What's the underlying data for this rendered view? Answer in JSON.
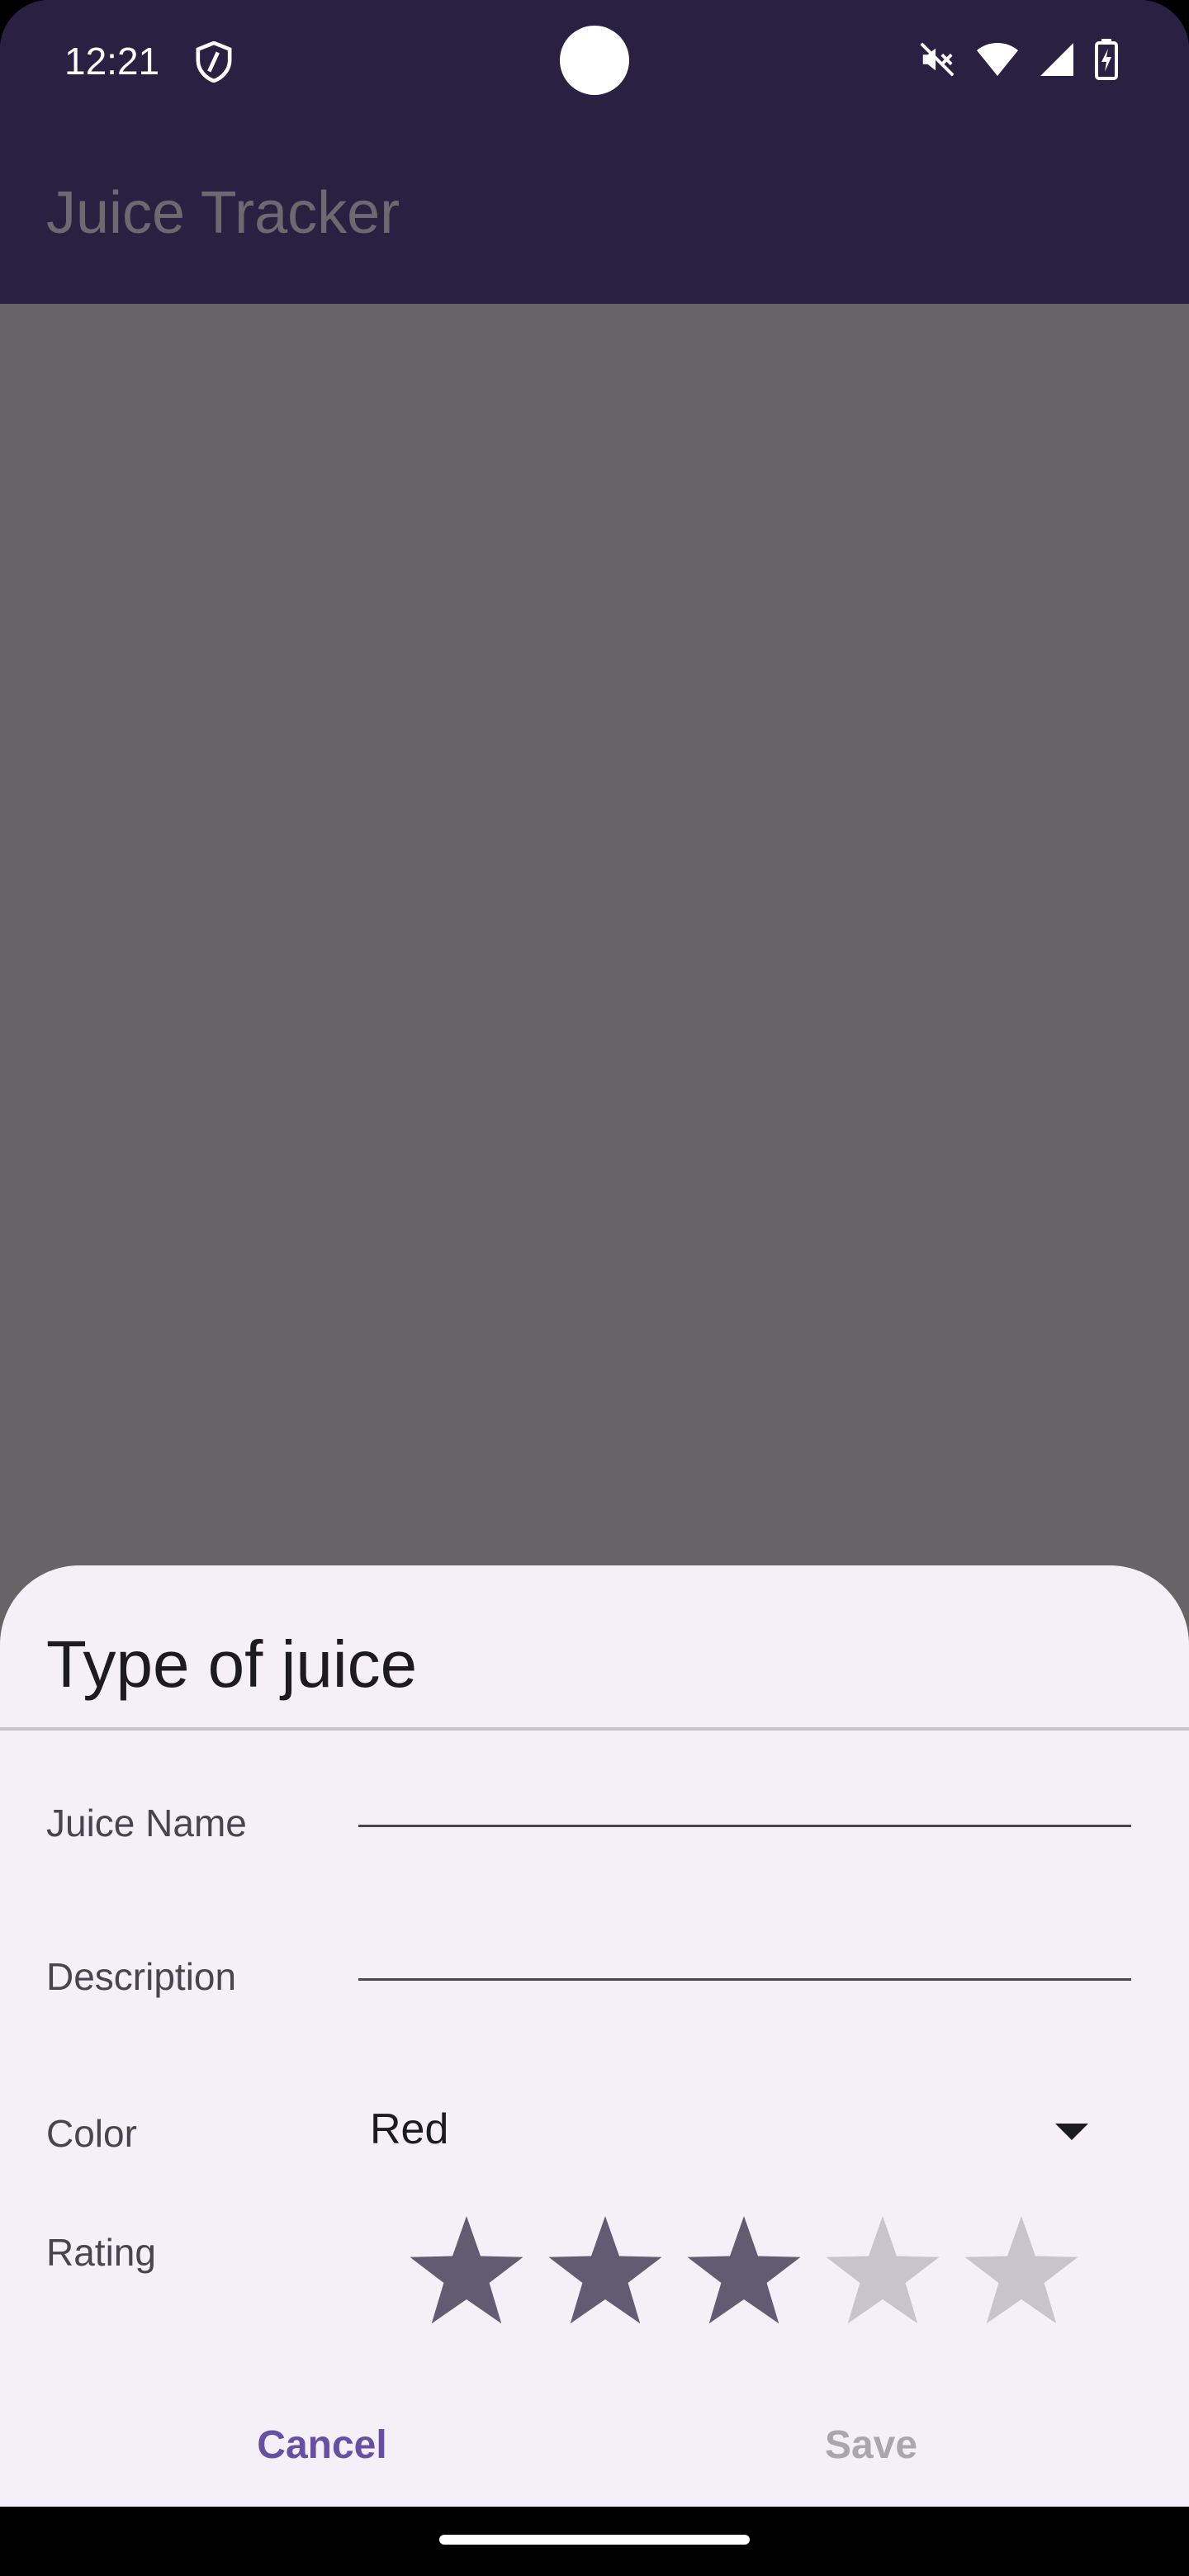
{
  "status_bar": {
    "time": "12:21",
    "icons": [
      "shield-icon",
      "vibrate-off-icon",
      "wifi-icon",
      "signal-icon",
      "battery-charging-icon"
    ]
  },
  "app_bar": {
    "title": "Juice Tracker"
  },
  "sheet": {
    "title": "Type of juice",
    "fields": {
      "name": {
        "label": "Juice Name",
        "value": "",
        "placeholder": ""
      },
      "description": {
        "label": "Description",
        "value": "",
        "placeholder": ""
      },
      "color": {
        "label": "Color",
        "selected": "Red"
      },
      "rating": {
        "label": "Rating",
        "value": 3,
        "max": 5
      }
    },
    "buttons": {
      "cancel": "Cancel",
      "save": "Save"
    }
  },
  "colors": {
    "app_bar": "#2a2042",
    "scrim": "#666467",
    "sheet_bg": "#f5f0f8",
    "accent": "#6750a4",
    "star_filled": "#625b71",
    "star_empty": "#c9c4cc",
    "disabled_text": "#a9a6ad"
  }
}
